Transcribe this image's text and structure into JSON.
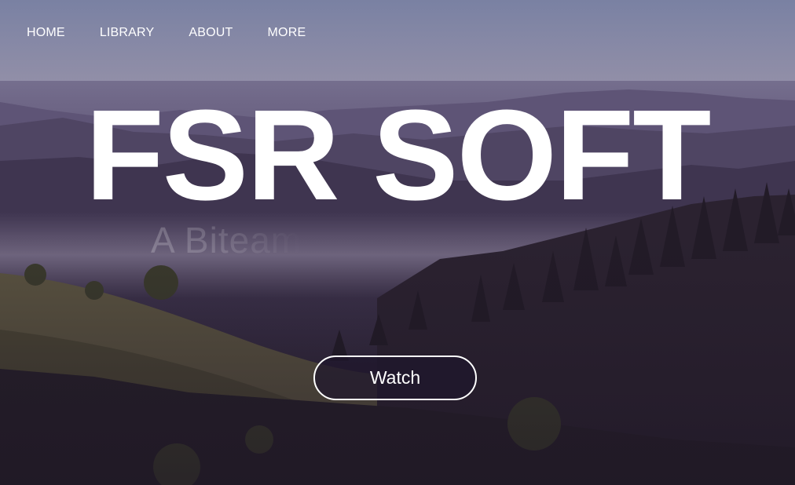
{
  "nav": {
    "items": [
      {
        "label": "HOME"
      },
      {
        "label": "LIBRARY"
      },
      {
        "label": "ABOUT"
      },
      {
        "label": "MORE"
      }
    ]
  },
  "hero": {
    "title": "FSR SOFT",
    "subtitle": "A Biteam",
    "watch_label": "Watch"
  },
  "colors": {
    "text": "#ffffff",
    "nav_background": "#7880a2",
    "button_background": "#1e162d"
  },
  "background": {
    "description_icon": "landscape-image"
  }
}
